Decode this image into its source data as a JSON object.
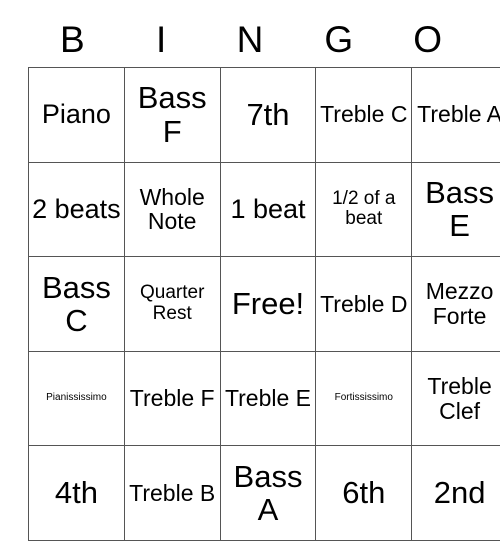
{
  "card": {
    "title": "BINGO",
    "header": {
      "letters": [
        "B",
        "I",
        "N",
        "G",
        "O"
      ]
    },
    "grid": {
      "columns": 5,
      "rows": 5,
      "free_space": "Free!",
      "cells": [
        [
          {
            "text": "Piano",
            "size": "lg"
          },
          {
            "text": "Bass F",
            "size": "xl"
          },
          {
            "text": "7th",
            "size": "xl"
          },
          {
            "text": "Treble C",
            "size": "md"
          },
          {
            "text": "Treble A",
            "size": "md"
          }
        ],
        [
          {
            "text": "2 beats",
            "size": "lg"
          },
          {
            "text": "Whole Note",
            "size": "md"
          },
          {
            "text": "1 beat",
            "size": "lg"
          },
          {
            "text": "1/2 of a beat",
            "size": "sm"
          },
          {
            "text": "Bass E",
            "size": "xl"
          }
        ],
        [
          {
            "text": "Bass C",
            "size": "xl"
          },
          {
            "text": "Quarter Rest",
            "size": "sm"
          },
          {
            "text": "Free!",
            "size": "xl"
          },
          {
            "text": "Treble D",
            "size": "md"
          },
          {
            "text": "Mezzo Forte",
            "size": "md"
          }
        ],
        [
          {
            "text": "Pianississimo",
            "size": "xs"
          },
          {
            "text": "Treble F",
            "size": "md"
          },
          {
            "text": "Treble E",
            "size": "md"
          },
          {
            "text": "Fortississimo",
            "size": "xs"
          },
          {
            "text": "Treble Clef",
            "size": "md"
          }
        ],
        [
          {
            "text": "4th",
            "size": "xl"
          },
          {
            "text": "Treble B",
            "size": "md"
          },
          {
            "text": "Bass A",
            "size": "xl"
          },
          {
            "text": "6th",
            "size": "xl"
          },
          {
            "text": "2nd",
            "size": "xl"
          }
        ]
      ]
    },
    "colors": {
      "background": "#ffffff",
      "text": "#000000",
      "grid_border": "#555555"
    }
  }
}
